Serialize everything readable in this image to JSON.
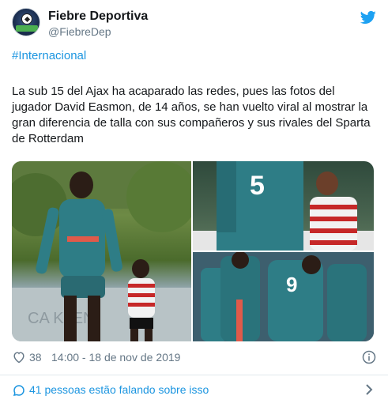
{
  "account": {
    "display_name": "Fiebre Deportiva",
    "handle": "@FiebreDep"
  },
  "tweet": {
    "hashtag": "#Internacional",
    "text": "La sub 15 del Ajax ha acaparado las redes, pues las fotos del jugador David Easmon, de 14 años, se han vuelto viral al mostrar la gran diferencia de talla con sus compañeros y sus rivales del Sparta de Rotterdam"
  },
  "media": {
    "photos": [
      {
        "number": "",
        "banner_text": "CA    KLEN"
      },
      {
        "number": "5",
        "banner_text": ""
      },
      {
        "number": "9",
        "banner_text": ""
      }
    ]
  },
  "footer": {
    "likes": "38",
    "timestamp": "14:00 - 18 de nov de 2019"
  },
  "conversation": {
    "label": "41 pessoas estão falando sobre isso"
  },
  "colors": {
    "link_blue": "#1b95e0",
    "twitter_blue": "#1da1f2",
    "secondary_text": "#657786",
    "ajax_teal": "#2e7d86",
    "sparta_red": "#c62828"
  },
  "icons": [
    "twitter-bird-icon",
    "heart-icon",
    "info-icon",
    "chat-bubble-icon",
    "chevron-right-icon"
  ]
}
